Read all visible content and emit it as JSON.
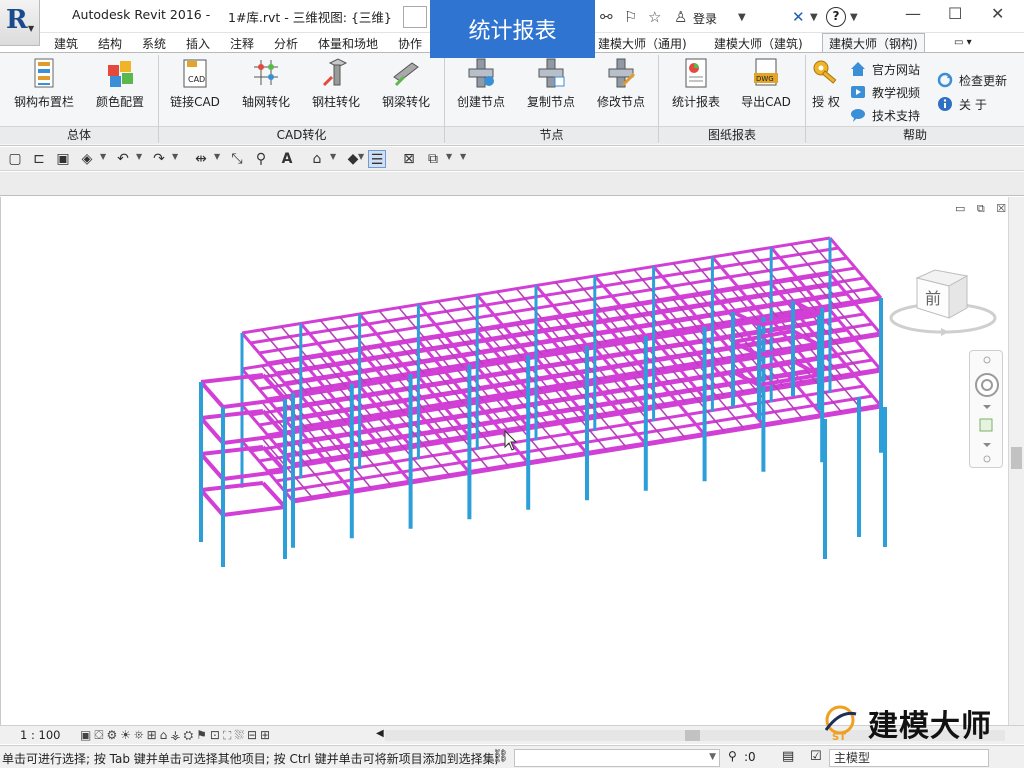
{
  "titlebar": {
    "app": "Autodesk Revit 2016 -",
    "file": "1#库.rvt - 三维视图: {三维}",
    "login": "登录"
  },
  "banner": "统计报表",
  "tabs": [
    "建筑",
    "结构",
    "系统",
    "插入",
    "注释",
    "分析",
    "体量和场地",
    "协作",
    "建模大师（通用)",
    "建模大师（建筑)",
    "建模大师（钢构)"
  ],
  "ribbon": {
    "buttons": [
      {
        "label": "钢构布置栏",
        "icon": "layout-panel-icon"
      },
      {
        "label": "颜色配置",
        "icon": "color-blocks-icon"
      },
      {
        "label": "链接CAD",
        "icon": "cad-link-icon"
      },
      {
        "label": "轴网转化",
        "icon": "grid-convert-icon"
      },
      {
        "label": "钢柱转化",
        "icon": "column-convert-icon"
      },
      {
        "label": "钢梁转化",
        "icon": "beam-convert-icon"
      },
      {
        "label": "创建节点",
        "icon": "create-node-icon"
      },
      {
        "label": "复制节点",
        "icon": "copy-node-icon"
      },
      {
        "label": "修改节点",
        "icon": "edit-node-icon"
      },
      {
        "label": "统计报表",
        "icon": "report-icon"
      },
      {
        "label": "导出CAD",
        "icon": "export-dwg-icon"
      },
      {
        "label": "授 权",
        "icon": "key-icon"
      }
    ],
    "cad_badge": "CAD",
    "dwg_badge": "DWG",
    "help_items": [
      "官方网站",
      "教学视频",
      "技术支持",
      "检查更新",
      "关 于"
    ],
    "groups": [
      "总体",
      "CAD转化",
      "节点",
      "图纸报表",
      "帮助"
    ]
  },
  "viewcube_label": "前",
  "viewbar": {
    "scale": "1 : 100"
  },
  "status": {
    "hint": "单击可进行选择; 按 Tab 键并单击可选择其他项目; 按 Ctrl 键并单击可将新项目添加到选择集;",
    "count": ":0",
    "model": "主模型"
  },
  "brand": {
    "name": "建模大师",
    "logo_letters": "ST"
  },
  "colors": {
    "beam": "#d23fd6",
    "column": "#2c9fd8",
    "banner": "#2f74d0"
  }
}
